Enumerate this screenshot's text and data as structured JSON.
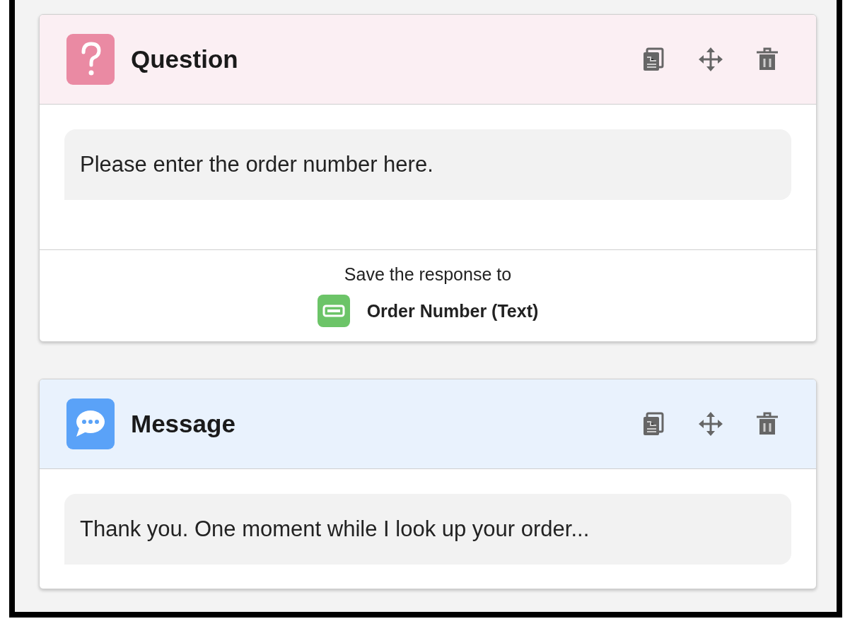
{
  "cards": [
    {
      "kind": "question",
      "title": "Question",
      "message": "Please enter the order number here.",
      "save": {
        "label": "Save the response to",
        "variable": "Order Number (Text)"
      }
    },
    {
      "kind": "message",
      "title": "Message",
      "message": "Thank you. One moment while I look up your order..."
    }
  ]
}
